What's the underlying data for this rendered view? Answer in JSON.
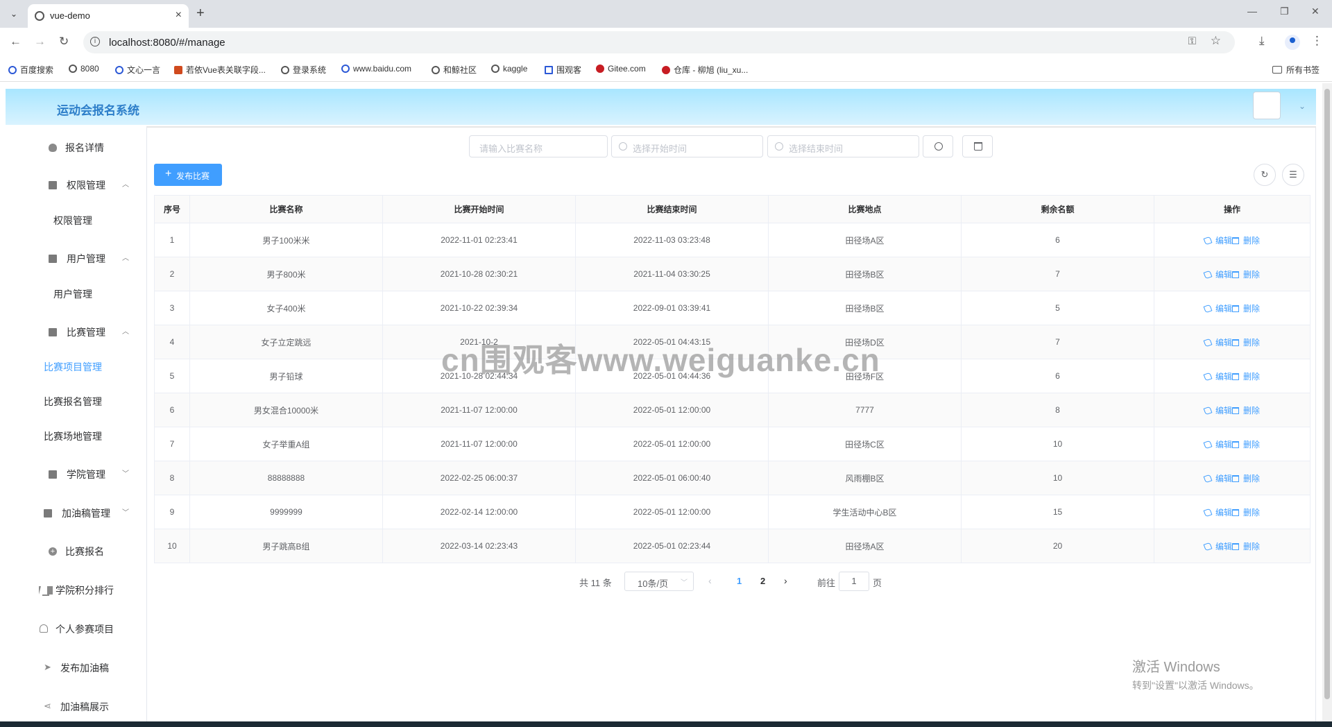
{
  "browser": {
    "tab_title": "vue-demo",
    "url": "localhost:8080/#/manage",
    "bookmarks": [
      "百度搜索",
      "8080",
      "文心一言",
      "若依Vue表关联字段...",
      "登录系统",
      "www.baidu.com",
      "和鲸社区",
      "kaggle",
      "围观客",
      "Gitee.com",
      "仓库 - 柳旭 (liu_xu..."
    ],
    "all_bookmarks": "所有书签"
  },
  "app": {
    "title": "运动会报名系统"
  },
  "sidebar": {
    "items": [
      {
        "label": "报名详情"
      },
      {
        "label": "权限管理"
      },
      {
        "label": "权限管理"
      },
      {
        "label": "用户管理"
      },
      {
        "label": "用户管理"
      },
      {
        "label": "比赛管理"
      },
      {
        "label": "比赛项目管理"
      },
      {
        "label": "比赛报名管理"
      },
      {
        "label": "比赛场地管理"
      },
      {
        "label": "学院管理"
      },
      {
        "label": "加油稿管理"
      },
      {
        "label": "比赛报名"
      },
      {
        "label": "学院积分排行"
      },
      {
        "label": "个人参赛项目"
      },
      {
        "label": "发布加油稿"
      },
      {
        "label": "加油稿展示"
      }
    ],
    "active": "比赛项目管理"
  },
  "search": {
    "name_placeholder": "请输入比赛名称",
    "start_placeholder": "选择开始时间",
    "end_placeholder": "选择结束时间"
  },
  "toolbar": {
    "publish_label": "发布比赛"
  },
  "table": {
    "headers": [
      "序号",
      "比赛名称",
      "比赛开始时间",
      "比赛结束时间",
      "比赛地点",
      "剩余名额",
      "操作"
    ],
    "rows": [
      [
        "1",
        "男子100米米",
        "2022-11-01 02:23:41",
        "2022-11-03 03:23:48",
        "田径场A区",
        "6"
      ],
      [
        "2",
        "男子800米",
        "2021-10-28 02:30:21",
        "2021-11-04 03:30:25",
        "田径场B区",
        "7"
      ],
      [
        "3",
        "女子400米",
        "2021-10-22 02:39:34",
        "2022-09-01 03:39:41",
        "田径场B区",
        "5"
      ],
      [
        "4",
        "女子立定跳远",
        "2021-10-2",
        "2022-05-01 04:43:15",
        "田径场D区",
        "7"
      ],
      [
        "5",
        "男子铅球",
        "2021-10-28 02:44:34",
        "2022-05-01 04:44:36",
        "田径场F区",
        "6"
      ],
      [
        "6",
        "男女混合10000米",
        "2021-11-07 12:00:00",
        "2022-05-01 12:00:00",
        "7777",
        "8"
      ],
      [
        "7",
        "女子举重A组",
        "2021-11-07 12:00:00",
        "2022-05-01 12:00:00",
        "田径场C区",
        "10"
      ],
      [
        "8",
        "88888888",
        "2022-02-25 06:00:37",
        "2022-05-01 06:00:40",
        "风雨棚B区",
        "10"
      ],
      [
        "9",
        "9999999",
        "2022-02-14 12:00:00",
        "2022-05-01 12:00:00",
        "学生活动中心B区",
        "15"
      ],
      [
        "10",
        "男子跳高B组",
        "2022-03-14 02:23:43",
        "2022-05-01 02:23:44",
        "田径场A区",
        "20"
      ]
    ],
    "edit_label": "编辑",
    "delete_label": "删除"
  },
  "pagination": {
    "total": "共 11 条",
    "page_size": "10条/页",
    "pages": [
      "1",
      "2"
    ],
    "current": "1",
    "goto_prefix": "前往",
    "goto_value": "1",
    "goto_suffix": "页"
  },
  "overlay": {
    "watermark": "cn围观客www.weiguanke.cn",
    "activate_line1": "激活 Windows",
    "activate_line2": "转到\"设置\"以激活 Windows。"
  },
  "colors": {
    "primary": "#409eff",
    "header_gradient_top": "#a9e6ff",
    "title": "#2d7ec9"
  }
}
